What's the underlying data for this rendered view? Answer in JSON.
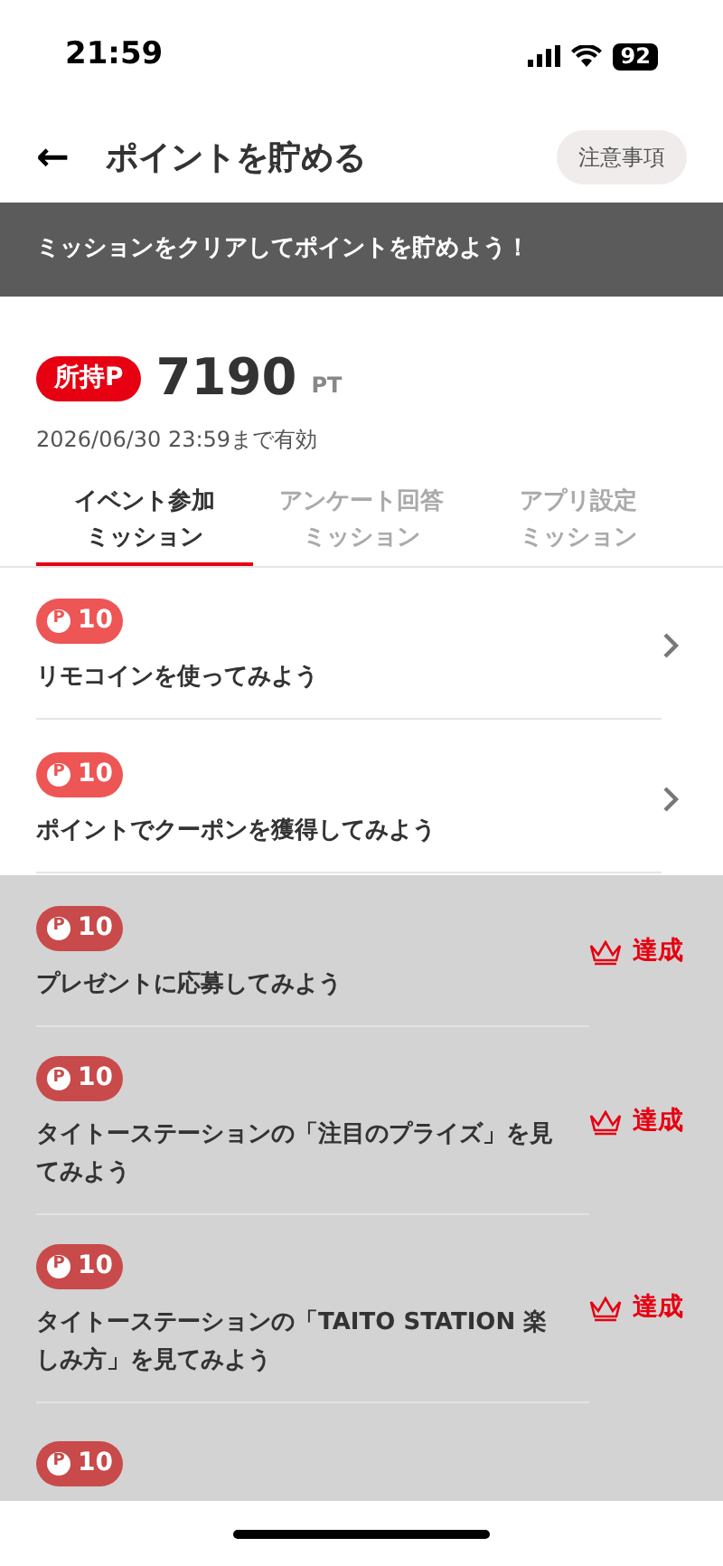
{
  "status_bar": {
    "time": "21:59",
    "battery": "92"
  },
  "header": {
    "back": "←",
    "title": "ポイントを貯める",
    "notice_button": "注意事項"
  },
  "banner": "ミッションをクリアしてポイントを貯めよう！",
  "points": {
    "label": "所持P",
    "value": "7190",
    "unit": "PT",
    "expiry": "2026/06/30 23:59まで有効"
  },
  "tabs": [
    {
      "line1": "イベント参加",
      "line2": "ミッション",
      "selected": true
    },
    {
      "line1": "アンケート回答",
      "line2": "ミッション",
      "selected": false
    },
    {
      "line1": "アプリ設定",
      "line2": "ミッション",
      "selected": false
    }
  ],
  "missions": [
    {
      "coin": "P",
      "points": "10",
      "title": "リモコインを使ってみよう",
      "achieved": false
    },
    {
      "coin": "P",
      "points": "10",
      "title": "ポイントでクーポンを獲得してみよう",
      "achieved": false
    },
    {
      "coin": "P",
      "points": "10",
      "title": "プレゼントに応募してみよう",
      "achieved": true,
      "status": "達成"
    },
    {
      "coin": "P",
      "points": "10",
      "title": "タイトーステーションの「注目のプライズ」を見てみよう",
      "achieved": true,
      "status": "達成"
    },
    {
      "coin": "P",
      "points": "10",
      "title": "タイトーステーションの「TAITO STATION 楽しみ方」を見てみよう",
      "achieved": true,
      "status": "達成"
    },
    {
      "coin": "P",
      "points": "10",
      "achieved": true
    }
  ]
}
